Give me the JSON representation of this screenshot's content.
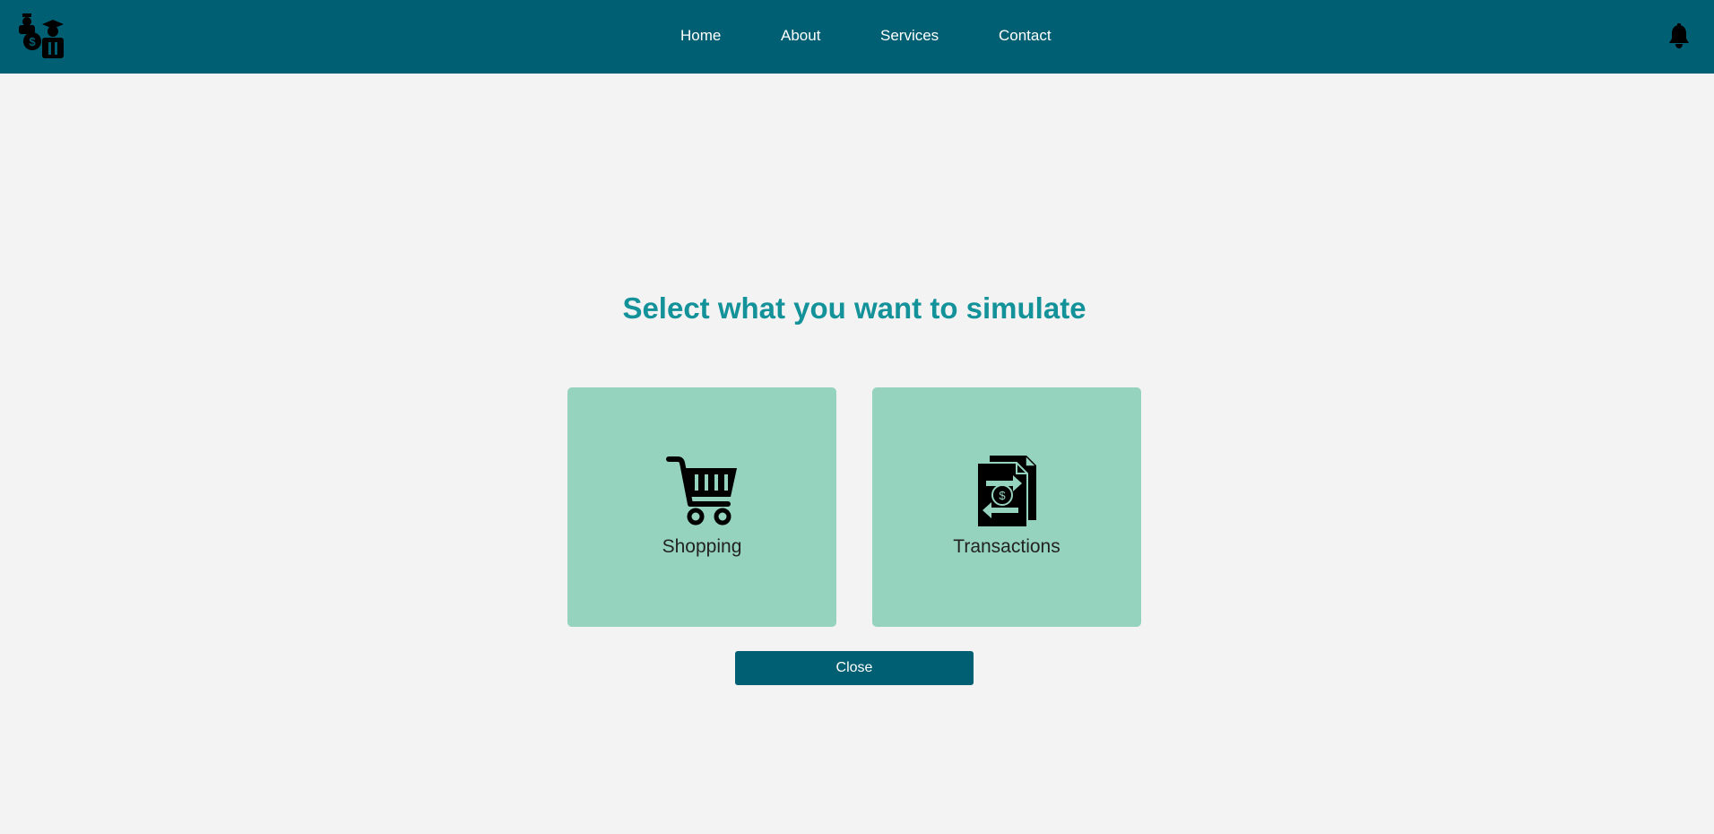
{
  "navbar": {
    "logo_icon": "money-people-icon",
    "links": [
      {
        "label": "Home"
      },
      {
        "label": "About"
      },
      {
        "label": "Services"
      },
      {
        "label": "Contact"
      }
    ],
    "notification_icon": "bell-icon"
  },
  "main": {
    "heading": "Select what you want to simulate",
    "options": [
      {
        "label": "Shopping",
        "icon": "shopping-cart-icon"
      },
      {
        "label": "Transactions",
        "icon": "transaction-document-icon"
      }
    ],
    "close_label": "Close"
  },
  "colors": {
    "navbar": "#005f73",
    "heading": "#13929a",
    "card": "#95d3bf",
    "background": "#f3f3f3"
  }
}
